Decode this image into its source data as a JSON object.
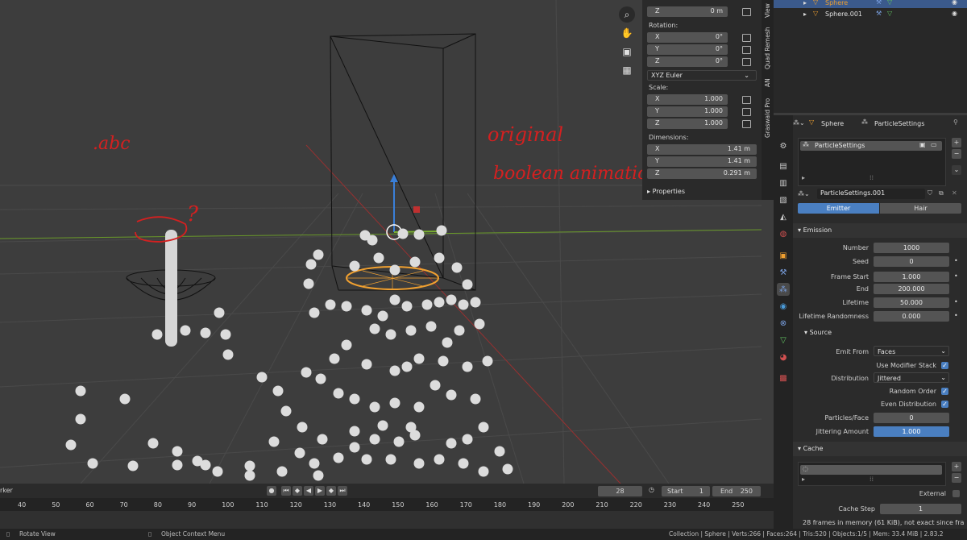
{
  "viewport": {
    "annotations": {
      "abc": ".abc",
      "question": "?",
      "original_line1": "original",
      "original_line2": "boolean animation"
    }
  },
  "npanel": {
    "z_label": "Z",
    "z_value": "0 m",
    "rotation_label": "Rotation:",
    "rot_x": {
      "axis": "X",
      "value": "0°"
    },
    "rot_y": {
      "axis": "Y",
      "value": "0°"
    },
    "rot_z": {
      "axis": "Z",
      "value": "0°"
    },
    "rotation_mode": "XYZ Euler",
    "scale_label": "Scale:",
    "scale_x": {
      "axis": "X",
      "value": "1.000"
    },
    "scale_y": {
      "axis": "Y",
      "value": "1.000"
    },
    "scale_z": {
      "axis": "Z",
      "value": "1.000"
    },
    "dimensions_label": "Dimensions:",
    "dim_x": {
      "axis": "X",
      "value": "1.41 m"
    },
    "dim_y": {
      "axis": "Y",
      "value": "1.41 m"
    },
    "dim_z": {
      "axis": "Z",
      "value": "0.291 m"
    },
    "properties_label": "Properties",
    "side_tabs": [
      "View",
      "Quad Remesh",
      "AN",
      "Graswald Pro"
    ]
  },
  "outliner": {
    "item1": "Sphere",
    "item2": "Sphere.001"
  },
  "properties": {
    "breadcrumb_object": "Sphere",
    "breadcrumb_settings": "ParticleSettings",
    "list_item": "ParticleSettings",
    "datablock_name": "ParticleSettings.001",
    "tab_emitter": "Emitter",
    "tab_hair": "Hair",
    "emission_header": "Emission",
    "number_label": "Number",
    "number_value": "1000",
    "seed_label": "Seed",
    "seed_value": "0",
    "frame_start_label": "Frame Start",
    "frame_start_value": "1.000",
    "end_label": "End",
    "end_value": "200.000",
    "lifetime_label": "Lifetime",
    "lifetime_value": "50.000",
    "lifetime_rand_label": "Lifetime Randomness",
    "lifetime_rand_value": "0.000",
    "source_header": "Source",
    "emit_from_label": "Emit From",
    "emit_from_value": "Faces",
    "use_modifier_stack_label": "Use Modifier Stack",
    "distribution_label": "Distribution",
    "distribution_value": "Jittered",
    "random_order_label": "Random Order",
    "even_distribution_label": "Even Distribution",
    "particles_face_label": "Particles/Face",
    "particles_face_value": "0",
    "jittering_label": "Jittering Amount",
    "jittering_value": "1.000",
    "jittering_fraction": 1.0,
    "cache_header": "Cache",
    "external_label": "External",
    "cache_step_label": "Cache Step",
    "cache_step_value": "1",
    "cache_info": "28 frames in memory (61 KiB), not exact since fra..."
  },
  "timeline": {
    "left_label": "rker",
    "current_frame": "28",
    "start_label": "Start",
    "start_value": "1",
    "end_label": "End",
    "end_value": "250",
    "ruler": [
      "40",
      "50",
      "60",
      "70",
      "80",
      "90",
      "100",
      "110",
      "120",
      "130",
      "140",
      "150",
      "160",
      "170",
      "180",
      "190",
      "200",
      "210",
      "220",
      "230",
      "240",
      "250"
    ]
  },
  "statusbar": {
    "left": "Rotate View",
    "middle": "Object Context Menu",
    "right": "Collection | Sphere | Verts:266 | Faces:264 | Tris:520 | Objects:1/5 | Mem: 33.4 MiB | 2.83.2"
  },
  "colors": {
    "accent": "#4a7fc1",
    "annotation_red": "#d42020",
    "selection_orange": "#f0a030",
    "axis_green": "#6a9a2a"
  }
}
